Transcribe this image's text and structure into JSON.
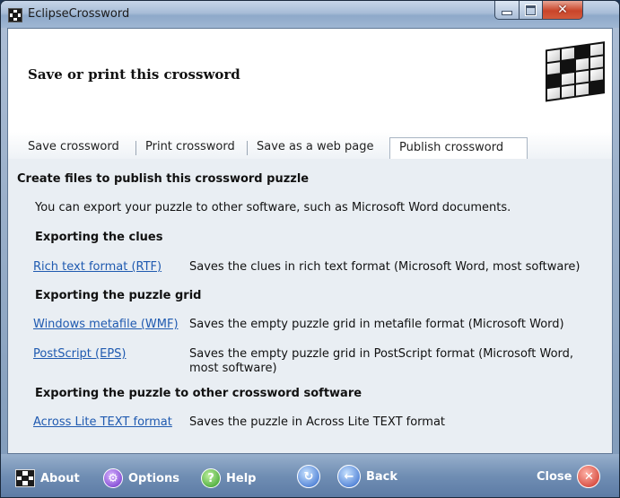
{
  "window": {
    "title": "EclipseCrossword"
  },
  "header": {
    "heading": "Save or print this crossword"
  },
  "tabs": [
    {
      "label": "Save crossword",
      "active": false
    },
    {
      "label": "Print crossword",
      "active": false
    },
    {
      "label": "Save as a web page",
      "active": false
    },
    {
      "label": "Publish crossword",
      "active": true
    }
  ],
  "panel": {
    "title": "Create files to publish this crossword puzzle",
    "intro": "You can export your puzzle to other software, such as Microsoft Word documents.",
    "sections": [
      {
        "heading": "Exporting the clues",
        "items": [
          {
            "link": "Rich text format (RTF)",
            "desc": "Saves the clues in rich text format (Microsoft Word, most software)"
          }
        ]
      },
      {
        "heading": "Exporting the puzzle grid",
        "items": [
          {
            "link": "Windows metafile (WMF)",
            "desc": "Saves the empty puzzle grid in metafile format (Microsoft Word)"
          },
          {
            "link": "PostScript (EPS)",
            "desc": "Saves the empty puzzle grid in PostScript format (Microsoft Word,",
            "desc2": "most software)"
          }
        ]
      },
      {
        "heading": "Exporting the puzzle to other crossword software",
        "items": [
          {
            "link": "Across Lite TEXT format",
            "desc": "Saves the puzzle in Across Lite TEXT format"
          }
        ]
      }
    ]
  },
  "footer": {
    "about": "About",
    "options": "Options",
    "help": "Help",
    "back": "Back",
    "close": "Close"
  },
  "icons": {
    "app": "crossword-grid-icon",
    "options": "options-icon",
    "help": "help-icon",
    "history": "history-icon",
    "back": "back-arrow-icon",
    "close": "close-icon"
  }
}
